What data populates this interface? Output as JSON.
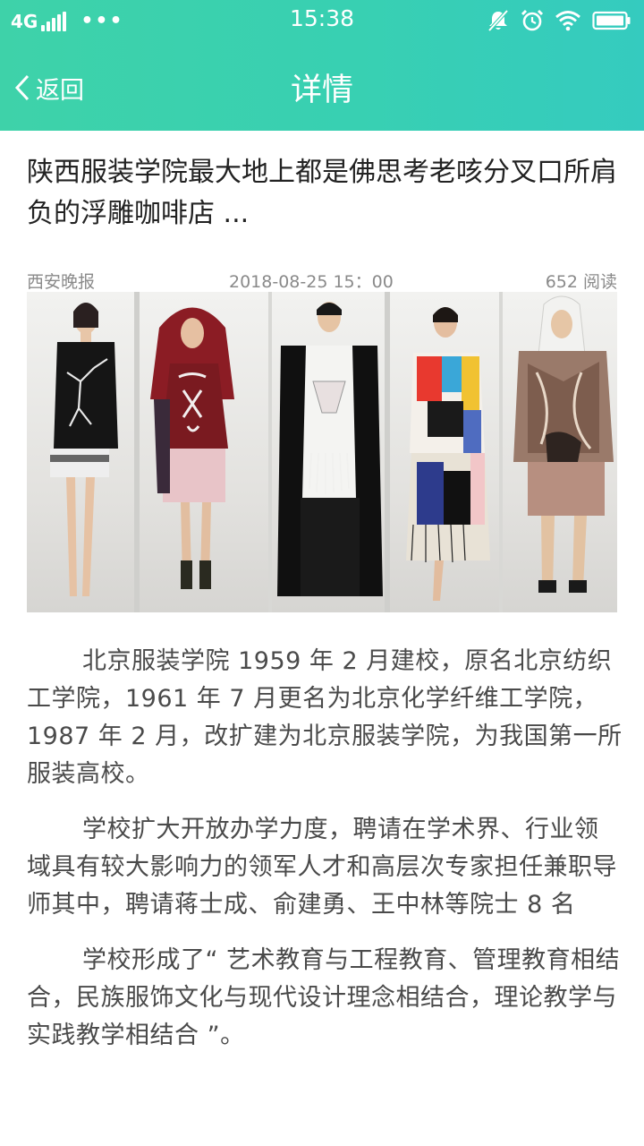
{
  "status_bar": {
    "network": "4G",
    "time": "15:38",
    "icons": [
      "signal-icon",
      "more-dots-icon",
      "mute-icon",
      "alarm-icon",
      "wifi-icon",
      "battery-icon"
    ]
  },
  "nav": {
    "back_label": "返回",
    "title": "详情"
  },
  "article": {
    "title": "陕西服装学院最大地上都是佛思考老咳分叉口所肩负的浮雕咖啡店 ...",
    "source": "西安晚报",
    "time": "2018-08-25  15：00",
    "reads": "652 阅读",
    "paragraphs": [
      "北京服装学院 1959 年 2 月建校，原名北京纺织工学院，1961 年 7 月更名为北京化学纤维工学院，1987 年 2 月，改扩建为北京服装学院，为我国第一所服装高校。",
      "学校扩大开放办学力度，聘请在学术界、行业领域具有较大影响力的领军人才和高层次专家担任兼职导师其中，聘请蒋士成、俞建勇、王中林等院士 8 名",
      "学校形成了“ 艺术教育与工程教育、管理教育相结合，民族服饰文化与现代设计理念相结合，理论教学与实践教学相结合 ”。"
    ]
  },
  "colors": {
    "header_start": "#3ed2a9",
    "header_end": "#35cbbf",
    "title_text": "#222222",
    "meta_text": "#8a8a8a",
    "body_text": "#4a4a4a"
  }
}
